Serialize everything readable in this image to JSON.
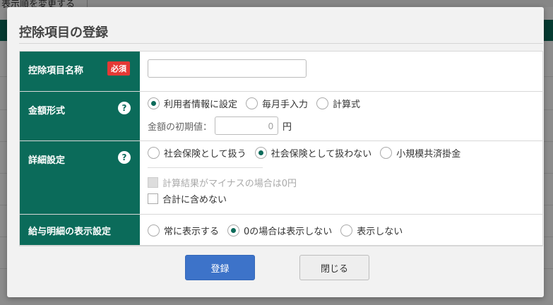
{
  "background": {
    "top_label": "表示順を変更する"
  },
  "modal": {
    "title": "控除項目の登録"
  },
  "form": {
    "name_row": {
      "label": "控除項目名称",
      "required_badge": "必須",
      "input_value": ""
    },
    "amount_row": {
      "label": "金額形式",
      "help": "?",
      "options": [
        {
          "label": "利用者情報に設定",
          "checked": true
        },
        {
          "label": "毎月手入力",
          "checked": false
        },
        {
          "label": "計算式",
          "checked": false
        }
      ],
      "initial_label": "金額の初期値：",
      "initial_value": "0",
      "unit": "円"
    },
    "detail_row": {
      "label": "詳細設定",
      "help": "?",
      "options": [
        {
          "label": "社会保険として扱う",
          "checked": false
        },
        {
          "label": "社会保険として扱わない",
          "checked": true
        },
        {
          "label": "小規模共済掛金",
          "checked": false
        }
      ],
      "checkboxes": [
        {
          "label": "計算結果がマイナスの場合は0円",
          "disabled": true,
          "checked": false
        },
        {
          "label": "合計に含めない",
          "disabled": false,
          "checked": false
        }
      ]
    },
    "display_row": {
      "label": "給与明細の表示設定",
      "options": [
        {
          "label": "常に表示する",
          "checked": false
        },
        {
          "label": "0の場合は表示しない",
          "checked": true
        },
        {
          "label": "表示しない",
          "checked": false
        }
      ]
    }
  },
  "buttons": {
    "register": "登録",
    "close": "閉じる"
  },
  "colors": {
    "label_bg": "#0b6b5a",
    "primary": "#3d73c9",
    "required": "#e53935"
  }
}
